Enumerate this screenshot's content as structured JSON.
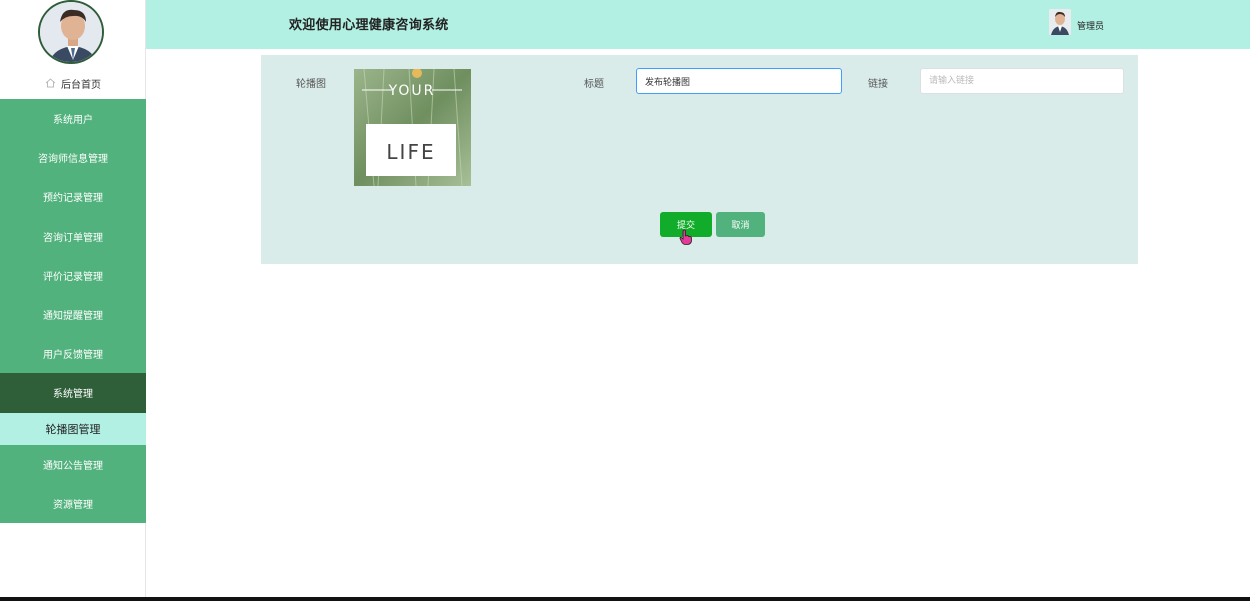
{
  "header": {
    "title": "欢迎使用心理健康咨询系统",
    "user_name": "管理员"
  },
  "sidebar": {
    "home_label": "后台首页",
    "items": [
      {
        "label": "系统用户"
      },
      {
        "label": "咨询师信息管理"
      },
      {
        "label": "预约记录管理"
      },
      {
        "label": "咨询订单管理"
      },
      {
        "label": "评价记录管理"
      },
      {
        "label": "通知提醒管理"
      },
      {
        "label": "用户反馈管理"
      },
      {
        "label": "系统管理"
      },
      {
        "label": "轮播图管理"
      },
      {
        "label": "通知公告管理"
      },
      {
        "label": "资源管理"
      }
    ]
  },
  "form": {
    "carousel_label": "轮播图",
    "image_text_top": "YOUR",
    "image_text_bottom": "LIFE",
    "title_label": "标题",
    "title_value": "发布轮播图",
    "link_label": "链接",
    "link_placeholder": "请输入链接",
    "submit_label": "提交",
    "cancel_label": "取消"
  },
  "colors": {
    "header_bg": "#b2f0e3",
    "menu_bg": "#52b27d",
    "menu_active_bg": "#2f5f39",
    "submenu_active_bg": "#b2f0e3",
    "panel_bg": "#daecea",
    "submit_bg": "#11ad2a"
  }
}
